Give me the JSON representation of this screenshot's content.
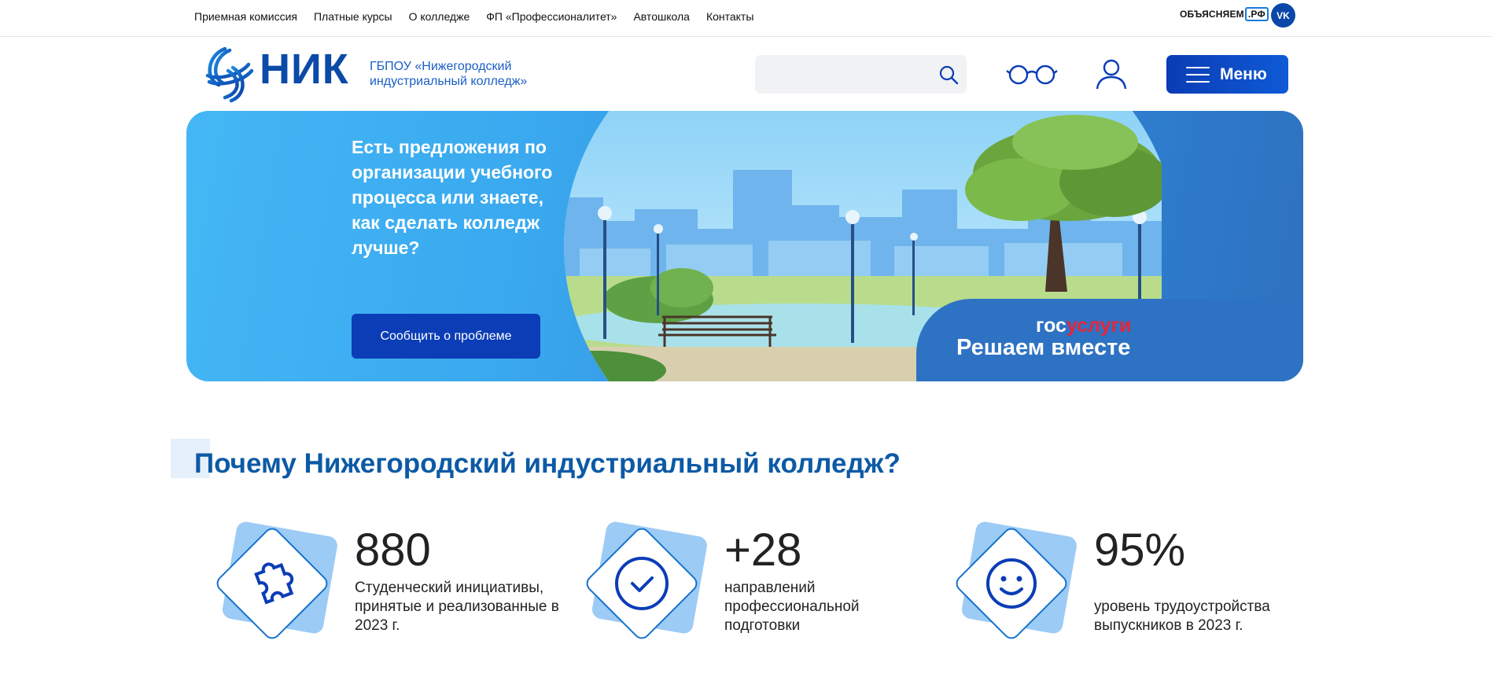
{
  "topnav": {
    "items": [
      "Приемная комиссия",
      "Платные курсы",
      "О колледже",
      "ФП «Профессионалитет»",
      "Автошкола",
      "Контакты"
    ],
    "obj_brand": "ОБЪЯСНЯЕМ",
    "obj_rf": ".РФ",
    "vk": "VK"
  },
  "header": {
    "logo_word": "НИК",
    "logo_sub": "ГБПОУ «Нижегородский индустриальный колледж»",
    "search_placeholder": "",
    "menu_label": "Меню"
  },
  "banner": {
    "text": "Есть предложения по организации учебного процесса или знаете, как сделать колледж лучше?",
    "button": "Сообщить о проблеме",
    "gos_part1": "гос",
    "gos_part2": "услуги",
    "gos_title": "Решаем вместе"
  },
  "section": {
    "title": "Почему Нижегородский индустриальный колледж?"
  },
  "stats": [
    {
      "value": "880",
      "desc": "Студенческий инициативы, принятые и реализованные в 2023 г.",
      "icon": "puzzle-icon"
    },
    {
      "value": "+28",
      "desc": "направлений профессиональной подготовки",
      "icon": "check-icon"
    },
    {
      "value": "95%",
      "desc": "уровень трудоустройства выпускников в 2023 г.",
      "icon": "smile-icon"
    }
  ],
  "colors": {
    "brand_blue": "#0a4aa8",
    "accent_blue": "#0b3db6",
    "banner_light": "#44b7f5",
    "gos_red": "#e8243a"
  }
}
